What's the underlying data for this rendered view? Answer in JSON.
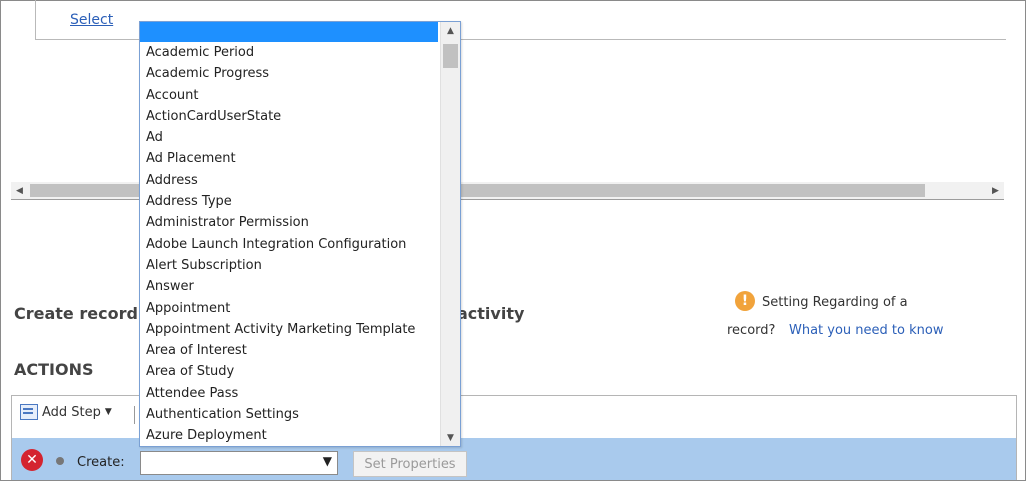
{
  "top": {
    "select_link": "Select"
  },
  "hscroll": {
    "left_icon": "left-arrow",
    "right_icon": "right-arrow"
  },
  "record": {
    "text_a": "Create record a",
    "text_b": "activity"
  },
  "info": {
    "icon": "warning",
    "line1": "Setting Regarding of a",
    "line2": "record?",
    "link": "What you need to know"
  },
  "actions": {
    "heading": "ACTIONS",
    "add_step_label": "Add Step",
    "create_label": "Create:",
    "entity_value": "",
    "set_properties_label": "Set Properties"
  },
  "dropdown": {
    "highlighted_value": "",
    "items": [
      "Academic Period",
      "Academic Progress",
      "Account",
      "ActionCardUserState",
      "Ad",
      "Ad Placement",
      "Address",
      "Address Type",
      "Administrator Permission",
      "Adobe Launch Integration Configuration",
      "Alert Subscription",
      "Answer",
      "Appointment",
      "Appointment Activity Marketing Template",
      "Area of Interest",
      "Area of Study",
      "Attendee Pass",
      "Authentication Settings",
      "Azure Deployment"
    ]
  },
  "colors": {
    "accent": "#1e90ff",
    "row_highlight": "#a9caed",
    "link": "#2b5fb8",
    "warning": "#f1a33b",
    "delete": "#d4242f"
  }
}
